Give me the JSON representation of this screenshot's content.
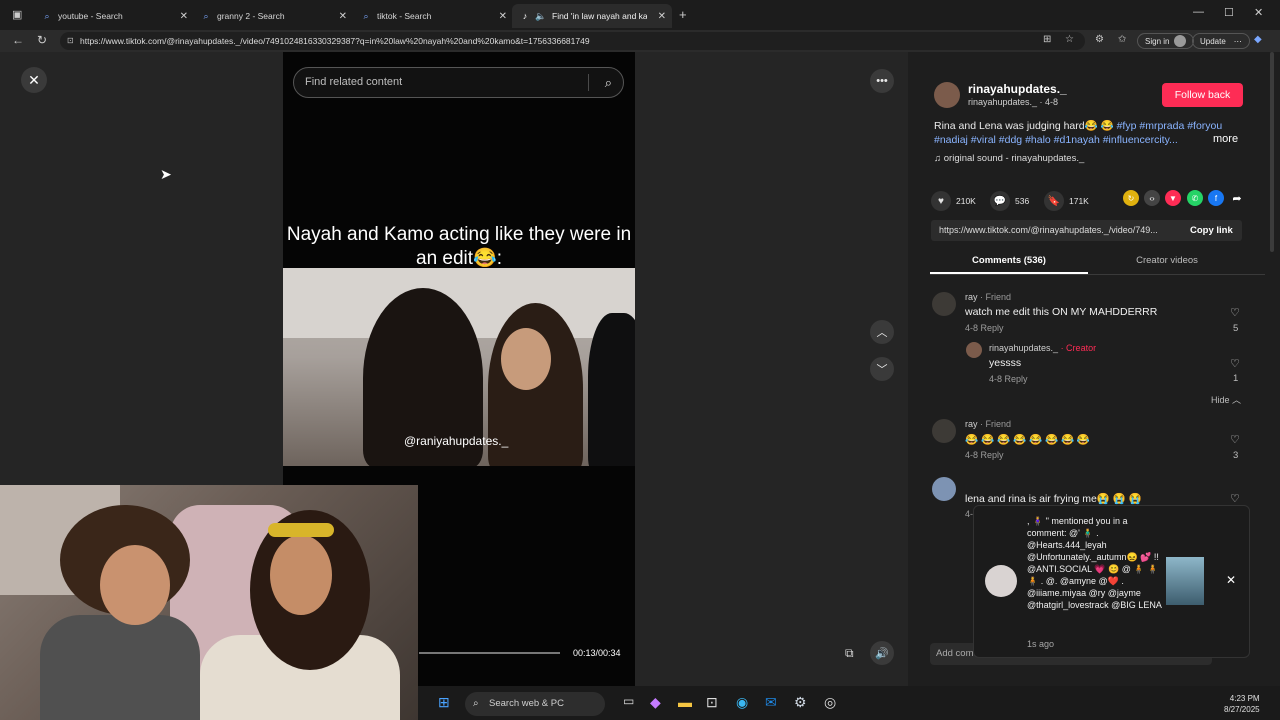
{
  "browser": {
    "tabs": [
      {
        "title": "youtube - Search"
      },
      {
        "title": "granny 2 - Search"
      },
      {
        "title": "tiktok - Search"
      },
      {
        "title": "Find 'in law nayah and kamo"
      }
    ],
    "url": "https://www.tiktok.com/@rinayahupdates._/video/7491024816330329387?q=in%20law%20nayah%20and%20kamo&t=1756336681749",
    "sign_in": "Sign in",
    "update": "Update"
  },
  "video": {
    "search_placeholder": "Find related content",
    "caption": "Nayah and Kamo acting like they were in an edit😂:",
    "watermark": "@raniyahupdates._",
    "time": "00:13/00:34"
  },
  "post": {
    "username": "rinayahupdates._",
    "handle": "rinayahupdates._ · 4-8",
    "follow": "Follow back",
    "desc_text": "Rina and Lena was judging hard😂 😂 ",
    "hashtags_line1": "#fyp #mrprada #foryou",
    "hashtags_line2": "#nadiaj #viral #ddg #halo #d1nayah #influencercity...",
    "more": "more",
    "sound": "♫  original sound - rinayahupdates._",
    "likes": "210K",
    "comments": "536",
    "saves": "171K",
    "link": "https://www.tiktok.com/@rinayahupdates._/video/749...",
    "copy": "Copy link"
  },
  "tabs": {
    "comments": "Comments (536)",
    "creator": "Creator videos"
  },
  "comments": [
    {
      "user": "ray",
      "rel": " · Friend",
      "text": "watch me edit this ON MY MAHDDERRR",
      "meta": "4-8     Reply",
      "likes": "5"
    },
    {
      "user": "rinayahupdates._",
      "rel": " · Creator",
      "text": "yessss",
      "meta": "4-8     Reply",
      "likes": "1"
    },
    {
      "user": "ray",
      "rel": " · Friend",
      "text": "😂 😂 😂 😂 😂 😂 😂 😂",
      "meta": "4-8     Reply",
      "likes": "3"
    },
    {
      "user": "",
      "rel": "",
      "text": "lena and rina is air frying me😭 😭 😭",
      "meta": "4-",
      "likes": ""
    }
  ],
  "hide": "Hide",
  "notification": {
    "text": ", 🧍‍♀️ \" mentioned you in a comment: @' 🧍‍♂️ . @Hearts.444_leyah @Unfortunately._autumn😖 💕 !! @ANTI.SOCIAL 💗 😊 @ 🧍 🧍 🧍 . @. @amyne @❤️ . @iiiame.miyaa @ry @jayme @thatgirl_lovestrack @BIG LENA",
    "time": "1s ago"
  },
  "add_comment": "Add com",
  "taskbar": {
    "search": "Search web & PC",
    "time": "4:23 PM",
    "date": "8/27/2025"
  }
}
